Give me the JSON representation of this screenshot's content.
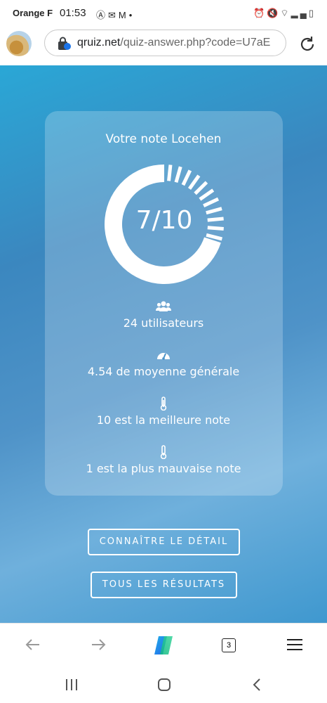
{
  "status_bar": {
    "carrier": "Orange F",
    "time": "01:53",
    "left_icons": [
      "alert-icon",
      "message-icon",
      "gmail-icon",
      "dot-icon"
    ],
    "right_icons": [
      "alarm-icon",
      "mute-icon",
      "wifi-icon",
      "signal-icon",
      "battery-icon"
    ]
  },
  "address_bar": {
    "domain": "qruiz.net",
    "path": "/quiz-answer.php?code=U7aE"
  },
  "result": {
    "title": "Votre note Locehen",
    "score": "7/10",
    "score_fraction": 0.7,
    "ring_color": "#ffffff"
  },
  "stats": [
    {
      "icon": "users-icon",
      "text": "24 utilisateurs"
    },
    {
      "icon": "gauge-icon",
      "text": "4.54 de moyenne générale"
    },
    {
      "icon": "thermometer-icon",
      "text": "10 est la meilleure note"
    },
    {
      "icon": "thermometer-icon",
      "text": "1 est la plus mauvaise note"
    }
  ],
  "buttons": {
    "detail": "CONNAÎTRE LE DÉTAIL",
    "all_results": "TOUS LES RÉSULTATS"
  },
  "browser_toolbar": {
    "tab_count": "3"
  },
  "colors": {
    "background_start": "#2aa7d6",
    "background_mid": "#3b87bf",
    "card": "rgba(255,255,255,0.22)"
  }
}
